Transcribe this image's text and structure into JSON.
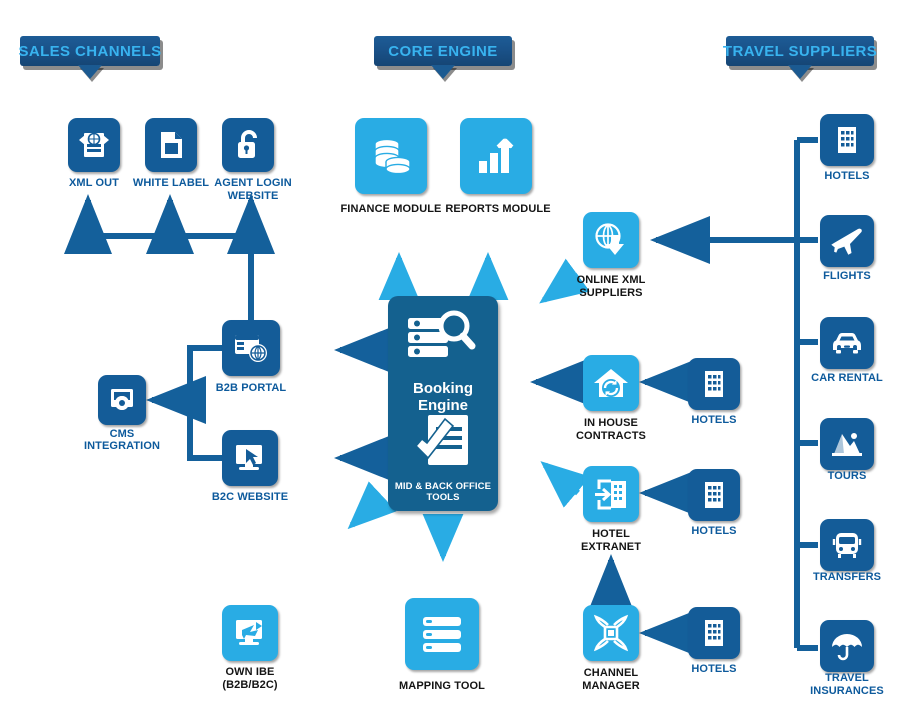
{
  "banners": [
    {
      "id": "sales-channels",
      "label": "SALES CHANNELS"
    },
    {
      "id": "core-engine",
      "label": "CORE ENGINE"
    },
    {
      "id": "travel-suppliers",
      "label": "TRAVEL SUPPLIERS"
    }
  ],
  "sales_channels": {
    "top_row": [
      {
        "id": "xml-out",
        "label": "XML OUT",
        "icon": "xml-document-icon"
      },
      {
        "id": "white-label",
        "label": "WHITE LABEL",
        "icon": "page-icon"
      },
      {
        "id": "agent-login-website",
        "label": "AGENT LOGIN WEBSITE",
        "icon": "padlock-icon"
      }
    ],
    "mid_items": [
      {
        "id": "b2b-portal",
        "label": "B2B PORTAL",
        "icon": "browser-globe-icon"
      },
      {
        "id": "cms-integration",
        "label": "CMS INTEGRATION",
        "icon": "cms-gear-icon"
      },
      {
        "id": "b2c-website",
        "label": "B2C WEBSITE",
        "icon": "monitor-cursor-icon"
      }
    ],
    "bottom_item": {
      "id": "own-ibe",
      "label": "OWN IBE (B2B/B2C)",
      "line1": "OWN IBE",
      "line2": "(B2B/B2C)",
      "icon": "monitor-plane-icon"
    }
  },
  "core_engine": {
    "modules": [
      {
        "id": "finance-module",
        "label": "FINANCE MODULE",
        "icon": "coins-stack-icon"
      },
      {
        "id": "reports-module",
        "label": "REPORTS MODULE",
        "icon": "bar-chart-arrow-icon"
      }
    ],
    "panel": {
      "id": "booking-engine-panel",
      "title": "Booking Engine",
      "footer": "MID & BACK OFFICE TOOLS",
      "top_icon": "server-search-icon",
      "bottom_icon": "document-check-icon"
    },
    "mapping_tool": {
      "id": "mapping-tool",
      "label": "MAPPING TOOL",
      "icon": "list-rows-icon"
    }
  },
  "suppliers_mid": [
    {
      "id": "online-xml-suppliers",
      "line1": "ONLINE XML",
      "line2": "SUPPLIERS",
      "label": "ONLINE XML SUPPLIERS",
      "icon": "globe-download-icon"
    },
    {
      "id": "in-house-contracts",
      "line1": "IN HOUSE",
      "line2": "CONTRACTS",
      "label": "IN HOUSE CONTRACTS",
      "icon": "house-refresh-icon"
    },
    {
      "id": "hotel-extranet",
      "line1": "HOTEL",
      "line2": "EXTRANET",
      "label": "HOTEL EXTRANET",
      "icon": "building-login-icon"
    },
    {
      "id": "channel-manager",
      "line1": "CHANNEL",
      "line2": "MANAGER",
      "label": "CHANNEL MANAGER",
      "icon": "channel-network-icon"
    }
  ],
  "hotels_feeders": [
    {
      "id": "hotels-in-house",
      "label": "HOTELS",
      "icon": "hotel-building-icon"
    },
    {
      "id": "hotels-extranet",
      "label": "HOTELS",
      "icon": "hotel-building-icon"
    },
    {
      "id": "hotels-channel",
      "label": "HOTELS",
      "icon": "hotel-building-icon"
    }
  ],
  "travel_suppliers": [
    {
      "id": "hotels",
      "label": "HOTELS",
      "icon": "hotel-building-icon"
    },
    {
      "id": "flights",
      "label": "FLIGHTS",
      "icon": "airplane-icon"
    },
    {
      "id": "car-rental",
      "label": "CAR RENTAL",
      "icon": "car-icon"
    },
    {
      "id": "tours",
      "label": "TOURS",
      "icon": "tour-landscape-icon"
    },
    {
      "id": "transfers",
      "label": "TRANSFERS",
      "icon": "bus-icon"
    },
    {
      "id": "travel-insurances",
      "line1": "TRAVEL",
      "line2": "INSURANCES",
      "label": "TRAVEL INSURANCES",
      "icon": "umbrella-icon"
    }
  ],
  "colors": {
    "dark_blue": "#145c98",
    "light_blue": "#29ace4",
    "panel_blue": "#14618f",
    "label_blue": "#0d5a9c",
    "banner_text": "#38b3ef",
    "line_blue": "#14609b",
    "background": "#ffffff"
  }
}
